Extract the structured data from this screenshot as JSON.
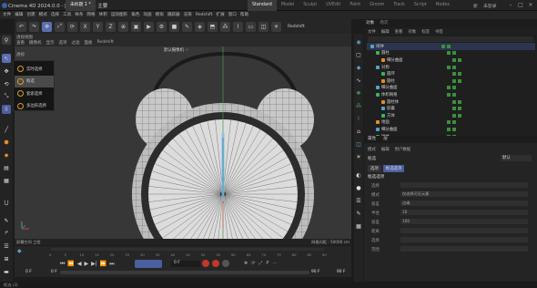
{
  "app": {
    "title": "Cinema 4D 2024.0.0 - [未标题 1 *] - 主要"
  },
  "tabs": {
    "doc": "未标题 1 *",
    "layouts": [
      "Standard",
      "Model",
      "Sculpt",
      "UVEdit",
      "Paint",
      "Groom",
      "Track",
      "Script",
      "Nodes"
    ],
    "new_doc": "新",
    "user_label": "未登录"
  },
  "menu": [
    "文件",
    "编辑",
    "创建",
    "模式",
    "选择",
    "工具",
    "样条",
    "网格",
    "体积",
    "运动图形",
    "角色",
    "动画",
    "模拟",
    "跟踪器",
    "渲染",
    "Redshift",
    "扩展",
    "窗口",
    "帮助"
  ],
  "toolbar": {
    "field": "Redshift"
  },
  "viewport": {
    "menu1": [
      "透视视图"
    ],
    "menu2": [
      "查看",
      "摄像机",
      "显示",
      "选项",
      "过滤",
      "面板",
      "Redshift"
    ],
    "camera_label": "默认摄像机 ·:·",
    "grid_label": "网格间距 : 50000 cm",
    "bottom_left": "屏幕空间  工程",
    "view_tag": "透视"
  },
  "popup": {
    "items": [
      "实时选择",
      "框选",
      "套索选择",
      "多边形选择"
    ],
    "selected_index": 1
  },
  "timeline": {
    "frame": "0 F",
    "start": "0 F",
    "start2": "0 F",
    "end": "90 F",
    "end2": "90 F",
    "ticks": [
      "0",
      "5",
      "10",
      "15",
      "20",
      "25",
      "30",
      "35",
      "40",
      "45",
      "50",
      "55",
      "60",
      "65",
      "70",
      "75",
      "80",
      "85",
      "90"
    ]
  },
  "objects": {
    "tabs": [
      "对象",
      "场次"
    ],
    "menu": [
      "文件",
      "编辑",
      "查看",
      "对象",
      "标签",
      "书签"
    ],
    "rows": [
      {
        "name": "闹钟",
        "indent": 0
      },
      {
        "name": "圆柱",
        "indent": 1
      },
      {
        "name": "细分曲面",
        "indent": 2
      },
      {
        "name": "对称",
        "indent": 1
      },
      {
        "name": "圆环",
        "indent": 2
      },
      {
        "name": "圆柱",
        "indent": 2
      },
      {
        "name": "细分曲面",
        "indent": 1
      },
      {
        "name": "体积网格",
        "indent": 1
      },
      {
        "name": "圆柱体",
        "indent": 2
      },
      {
        "name": "胶囊",
        "indent": 2
      },
      {
        "name": "方体",
        "indent": 2
      },
      {
        "name": "地面",
        "indent": 1
      },
      {
        "name": "细分曲面",
        "indent": 1
      },
      {
        "name": "球体",
        "indent": 1
      }
    ]
  },
  "attributes": {
    "tabs": [
      "属性",
      "层"
    ],
    "menu": [
      "模式",
      "编辑",
      "用户数据"
    ],
    "mode": "框选",
    "mode_value": "默认",
    "subtabs": [
      "选项",
      "框选选项"
    ],
    "section": "框选选项",
    "rows": [
      {
        "label": "选择",
        "value": ""
      },
      {
        "label": "模式",
        "value": "仅选择可见元素"
      },
      {
        "label": "容差",
        "value": "边缘"
      },
      {
        "label": "半径",
        "value": "10"
      },
      {
        "label": "容差",
        "value": "100"
      },
      {
        "label": "距离",
        "value": ""
      },
      {
        "label": "选择",
        "value": ""
      },
      {
        "label": "范围",
        "value": ""
      }
    ]
  },
  "status": {
    "text": "框选 (3)"
  }
}
